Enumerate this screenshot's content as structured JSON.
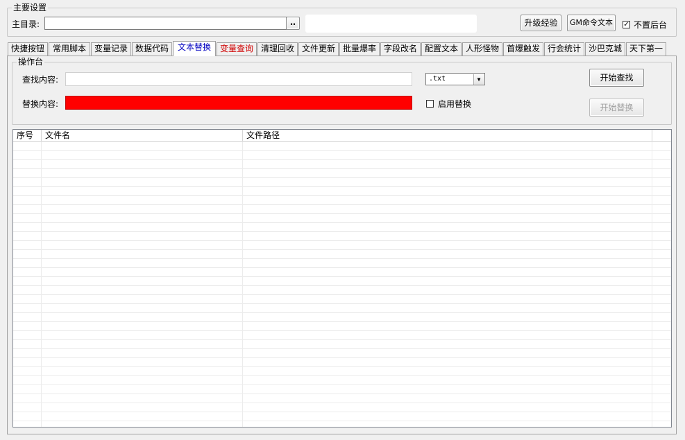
{
  "settings": {
    "group_title": "主要设置",
    "main_dir_label": "主目录:",
    "main_dir_value": "",
    "browse_label": "‥",
    "upgrade_button": "升级经验",
    "gm_button": "GM命令文本",
    "no_background_label": "不置后台",
    "no_background_checked": true
  },
  "tabs": [
    {
      "label": "快捷按钮",
      "active": false,
      "red": false
    },
    {
      "label": "常用脚本",
      "active": false,
      "red": false
    },
    {
      "label": "变量记录",
      "active": false,
      "red": false
    },
    {
      "label": "数据代码",
      "active": false,
      "red": false
    },
    {
      "label": "文本替换",
      "active": true,
      "red": false
    },
    {
      "label": "变量查询",
      "active": false,
      "red": true
    },
    {
      "label": "清理回收",
      "active": false,
      "red": false
    },
    {
      "label": "文件更新",
      "active": false,
      "red": false
    },
    {
      "label": "批量爆率",
      "active": false,
      "red": false
    },
    {
      "label": "字段改名",
      "active": false,
      "red": false
    },
    {
      "label": "配置文本",
      "active": false,
      "red": false
    },
    {
      "label": "人形怪物",
      "active": false,
      "red": false
    },
    {
      "label": "首爆触发",
      "active": false,
      "red": false
    },
    {
      "label": "行会统计",
      "active": false,
      "red": false
    },
    {
      "label": "沙巴克城",
      "active": false,
      "red": false
    },
    {
      "label": "天下第一",
      "active": false,
      "red": false
    }
  ],
  "console": {
    "group_title": "操作台",
    "find_label": "查找内容:",
    "find_value": "",
    "replace_label": "替换内容:",
    "replace_value": "",
    "replace_field_color": "#ff0000",
    "extension_selected": ".txt",
    "enable_replace_label": "启用替换",
    "enable_replace_checked": false,
    "start_find_button": "开始查找",
    "start_replace_button": "开始替换"
  },
  "results": {
    "columns": [
      "序号",
      "文件名",
      "文件路径"
    ],
    "rows": []
  }
}
